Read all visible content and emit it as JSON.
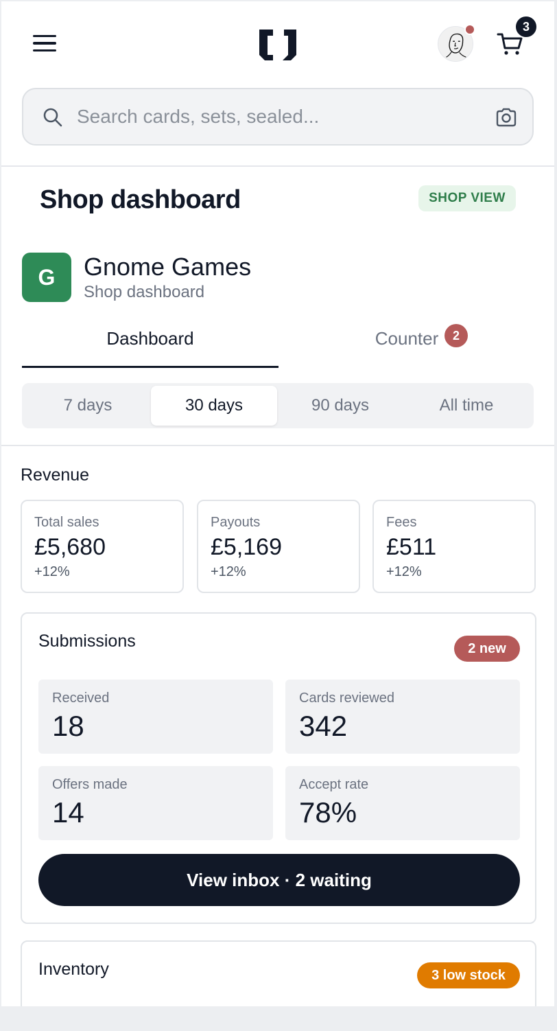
{
  "header": {
    "menu_icon": "hamburger-icon",
    "logo_icon": "bracket-logo",
    "avatar_icon": "face-sketch-avatar",
    "cart_icon": "cart-icon",
    "cart_count": "3",
    "notification_color": "#b55a59"
  },
  "search": {
    "placeholder": "Search cards, sets, sealed...",
    "search_icon": "search-icon",
    "camera_icon": "camera-icon"
  },
  "page": {
    "title": "Shop dashboard",
    "view_badge": "SHOP VIEW"
  },
  "shop": {
    "initial": "G",
    "name": "Gnome Games",
    "subtitle": "Shop dashboard",
    "brand_color": "#2e8b57"
  },
  "tabs": [
    {
      "label": "Dashboard",
      "active": true
    },
    {
      "label": "Counter",
      "badge": "2"
    }
  ],
  "ranges": [
    {
      "label": "7 days"
    },
    {
      "label": "30 days",
      "active": true
    },
    {
      "label": "90 days"
    },
    {
      "label": "All time"
    }
  ],
  "revenue": {
    "title": "Revenue",
    "cards": [
      {
        "label": "Total sales",
        "value": "£5,680",
        "change": "+12%"
      },
      {
        "label": "Payouts",
        "value": "£5,169",
        "change": "+12%"
      },
      {
        "label": "Fees",
        "value": "£511",
        "change": "+12%"
      }
    ]
  },
  "submissions": {
    "title": "Submissions",
    "badge": "2 new",
    "badge_color": "#b55a59",
    "metrics": [
      {
        "label": "Received",
        "value": "18"
      },
      {
        "label": "Cards reviewed",
        "value": "342"
      },
      {
        "label": "Offers made",
        "value": "14"
      },
      {
        "label": "Accept rate",
        "value": "78%"
      }
    ],
    "cta": "View inbox · 2 waiting"
  },
  "inventory": {
    "title": "Inventory",
    "badge": "3 low stock",
    "badge_color": "#e07b00"
  }
}
